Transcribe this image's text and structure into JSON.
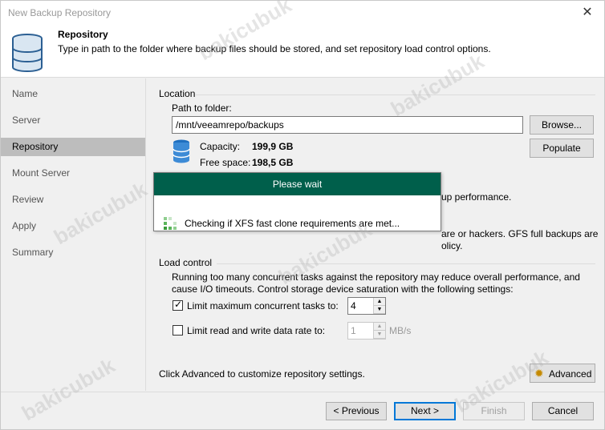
{
  "window": {
    "title": "New Backup Repository",
    "close_glyph": "✕"
  },
  "header": {
    "title": "Repository",
    "description": "Type in path to the folder where backup files should be stored, and set repository load control options.",
    "icon": "database-icon"
  },
  "nav": {
    "items": [
      {
        "label": "Name",
        "active": false
      },
      {
        "label": "Server",
        "active": false
      },
      {
        "label": "Repository",
        "active": true
      },
      {
        "label": "Mount Server",
        "active": false
      },
      {
        "label": "Review",
        "active": false
      },
      {
        "label": "Apply",
        "active": false
      },
      {
        "label": "Summary",
        "active": false
      }
    ]
  },
  "location": {
    "section_label": "Location",
    "path_label": "Path to folder:",
    "path_value": "/mnt/veeamrepo/backups",
    "browse_label": "Browse...",
    "populate_label": "Populate",
    "capacity_label": "Capacity:",
    "capacity_value": "199,9 GB",
    "free_label": "Free space:",
    "free_value": "198,5 GB",
    "hidden_text_1": "up performance.",
    "hidden_text_2": "are or hackers. GFS full backups are",
    "hidden_text_3": "olicy."
  },
  "load_control": {
    "section_label": "Load control",
    "description": "Running too many concurrent tasks against the repository may reduce overall performance, and cause I/O timeouts. Control storage device saturation with the following settings:",
    "limit_tasks_label": "Limit maximum concurrent tasks to:",
    "limit_tasks_checked": true,
    "limit_tasks_value": "4",
    "limit_rate_label": "Limit read and write data rate to:",
    "limit_rate_checked": false,
    "limit_rate_value": "1",
    "limit_rate_unit": "MB/s"
  },
  "advanced": {
    "hint": "Click Advanced to customize repository settings.",
    "button_label": "Advanced"
  },
  "footer": {
    "previous_label": "< Previous",
    "next_label": "Next >",
    "finish_label": "Finish",
    "cancel_label": "Cancel"
  },
  "dialog": {
    "title": "Please wait",
    "message": "Checking if XFS fast clone requirements are met..."
  },
  "watermark": "bakicubuk",
  "colors": {
    "dialog_header": "#005f4b",
    "nav_active": "#bdbdbd",
    "accent": "#0078d7"
  }
}
